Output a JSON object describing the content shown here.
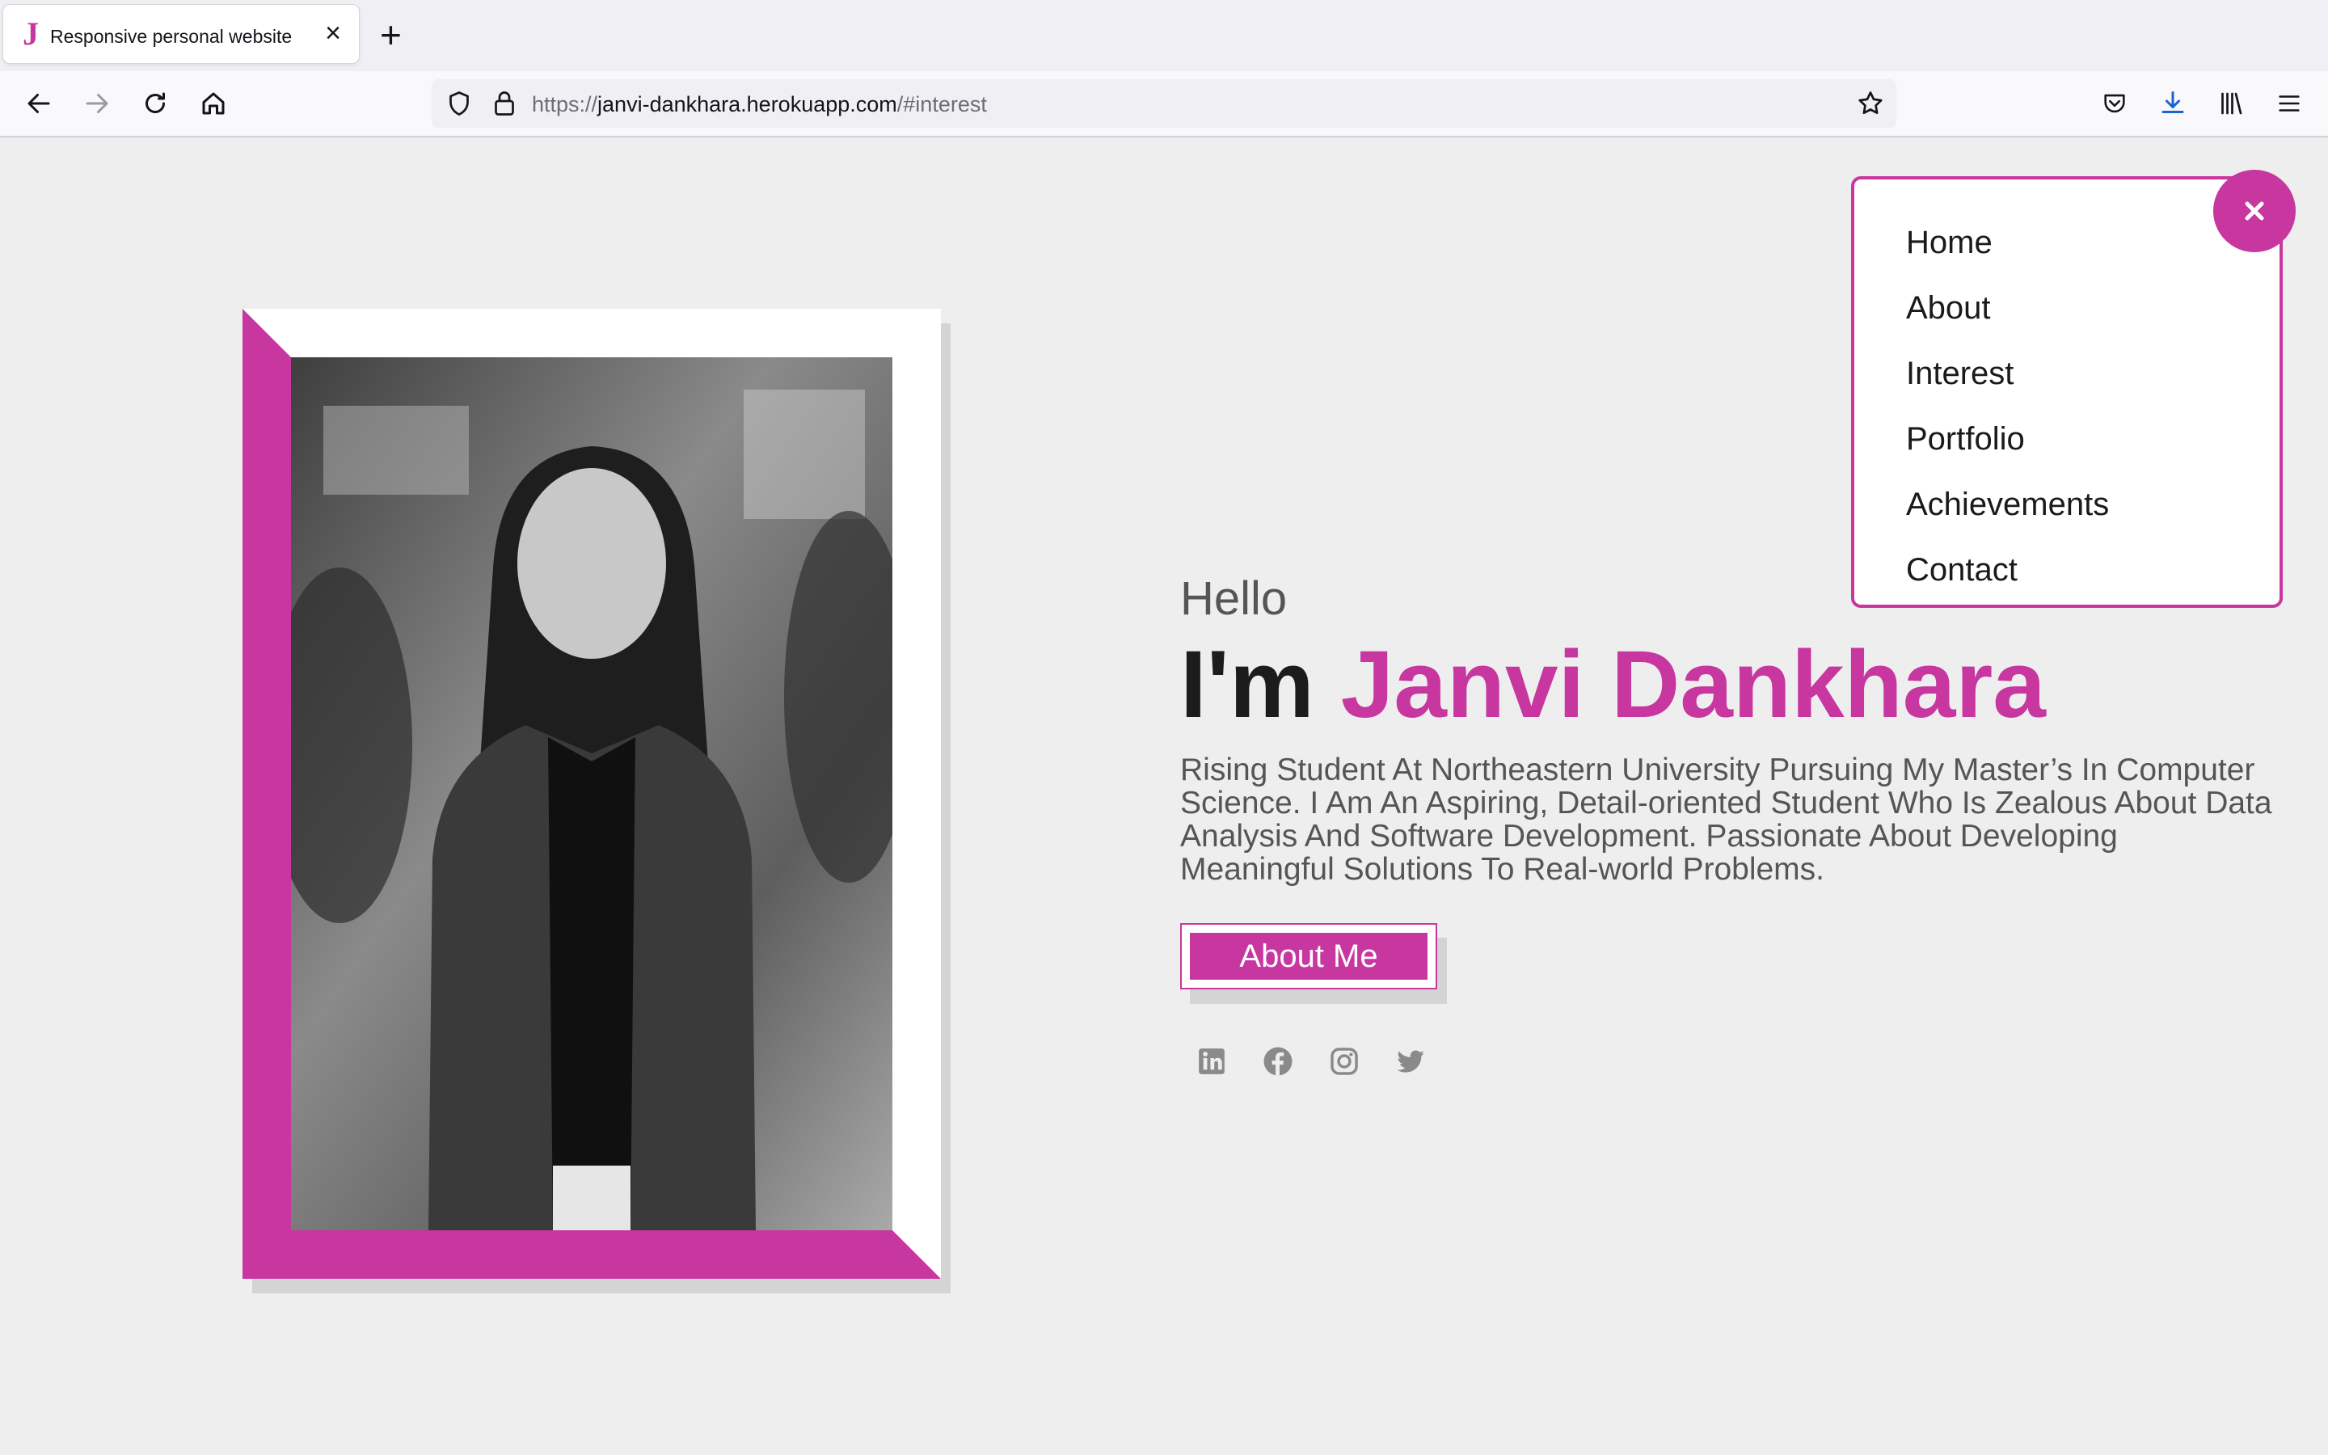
{
  "browser": {
    "tab_title": "Responsive personal website",
    "tab_favicon": "J",
    "url_prefix": "https://",
    "url_host": "janvi-dankhara.herokuapp.com",
    "url_hash": "/#interest"
  },
  "hero": {
    "greeting": "Hello",
    "intro": "I'm ",
    "name": "Janvi Dankhara",
    "bio": "Rising Student At Northeastern University Pursuing My Master’s In Computer Science. I Am An Aspiring, Detail-oriented Student Who Is Zealous About Data Analysis And Software Development. Passionate About Developing Meaningful Solutions To Real-world Problems.",
    "cta_label": "About Me"
  },
  "menu": {
    "items": [
      "Home",
      "About",
      "Interest",
      "Portfolio",
      "Achievements",
      "Contact"
    ]
  },
  "socials": [
    "linkedin-icon",
    "facebook-icon",
    "instagram-icon",
    "twitter-icon"
  ],
  "colors": {
    "accent": "#c8369f",
    "page_bg": "#eeeeef",
    "text_dark": "#1c1c1c",
    "text_muted": "#555555"
  }
}
